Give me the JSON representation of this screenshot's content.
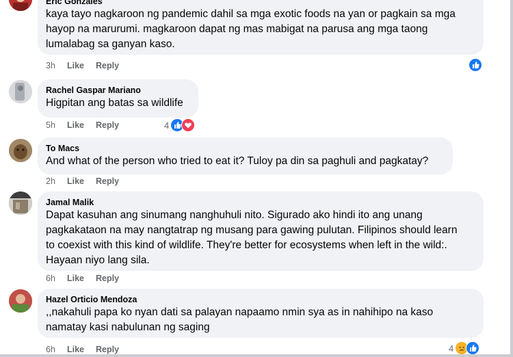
{
  "comments": [
    {
      "author": "Eric Gonzales",
      "text": "kaya tayo nagkaroon ng pandemic dahil sa mga exotic foods na yan or pagkain sa mga\nhayop na marurumi. magkaroon dapat ng mas mabigat na parusa ang mga taong\nlumalabag sa ganyan kaso.",
      "time": "3h",
      "like": "Like",
      "reply": "Reply",
      "reactions": {
        "count": "",
        "icons": [
          "like-icon"
        ]
      }
    },
    {
      "author": "Rachel Gaspar Mariano",
      "text": "Higpitan ang batas sa wildlife",
      "time": "5h",
      "like": "Like",
      "reply": "Reply",
      "reactions": {
        "count": "4",
        "icons": [
          "like-icon",
          "heart-icon"
        ]
      }
    },
    {
      "author": "To Macs",
      "text": "And what of the person who tried to eat it? Tuloy pa din sa paghuli and pagkatay?",
      "time": "2h",
      "like": "Like",
      "reply": "Reply"
    },
    {
      "author": "Jamal Malik",
      "text": "Dapat kasuhan ang sinumang nanghuhuli nito. Sigurado ako hindi ito ang unang\npagkakataon na may nangtatrap ng musang para gawing pulutan. Filipinos should learn\nto coexist with this kind of wildlife. They're better for ecosystems when left in the wild:.\nHayaan niyo lang sila.",
      "time": "6h",
      "like": "Like",
      "reply": "Reply"
    },
    {
      "author": "Hazel Orticio Mendoza",
      "text": ",,nakahuli papa ko nyan dati sa palayan napaamo nmin sya as in nahihipo na kaso\nnamatay kasi nabulunan ng saging",
      "time": "6h",
      "like": "Like",
      "reply": "Reply",
      "reactions": {
        "count": "4",
        "icons": [
          "sad-icon",
          "like-icon"
        ]
      }
    }
  ],
  "colors": {
    "bubble": "#f0f2f5",
    "like_blue": "#1877f2",
    "heart_red": "#f33e58",
    "sad_yellow": "#f7b125",
    "meta_gray": "#65676b"
  }
}
